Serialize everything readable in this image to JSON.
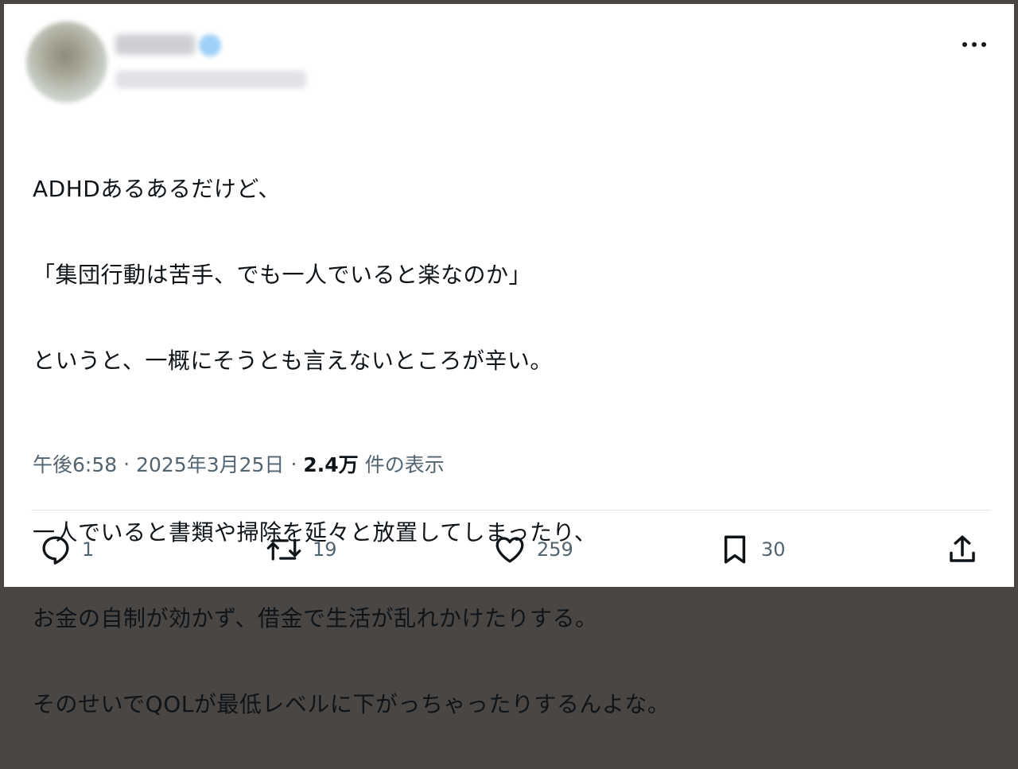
{
  "tweet": {
    "lines_para1": [
      "ADHDあるあるだけど、",
      "「集団行動は苦手、でも一人でいると楽なのか」",
      "というと、一概にそうとも言えないところが辛い。"
    ],
    "lines_para2": [
      "一人でいると書類や掃除を延々と放置してしまったり、",
      "お金の自制が効かず、借金で生活が乱れかけたりする。",
      "そのせいでQOLが最低レベルに下がっちゃったりするんよな。"
    ],
    "time": "午後6:58",
    "date": "2025年3月25日",
    "separator": "·",
    "views_count": "2.4万",
    "views_label": "件の表示"
  },
  "actions": {
    "reply_count": "1",
    "retweet_count": "19",
    "like_count": "259",
    "bookmark_count": "30"
  },
  "colors": {
    "text": "#0f1419",
    "secondary": "#536471",
    "divider": "#e1e6ea"
  },
  "icons": [
    "more-icon",
    "reply-icon",
    "retweet-icon",
    "like-icon",
    "bookmark-icon",
    "share-icon"
  ]
}
